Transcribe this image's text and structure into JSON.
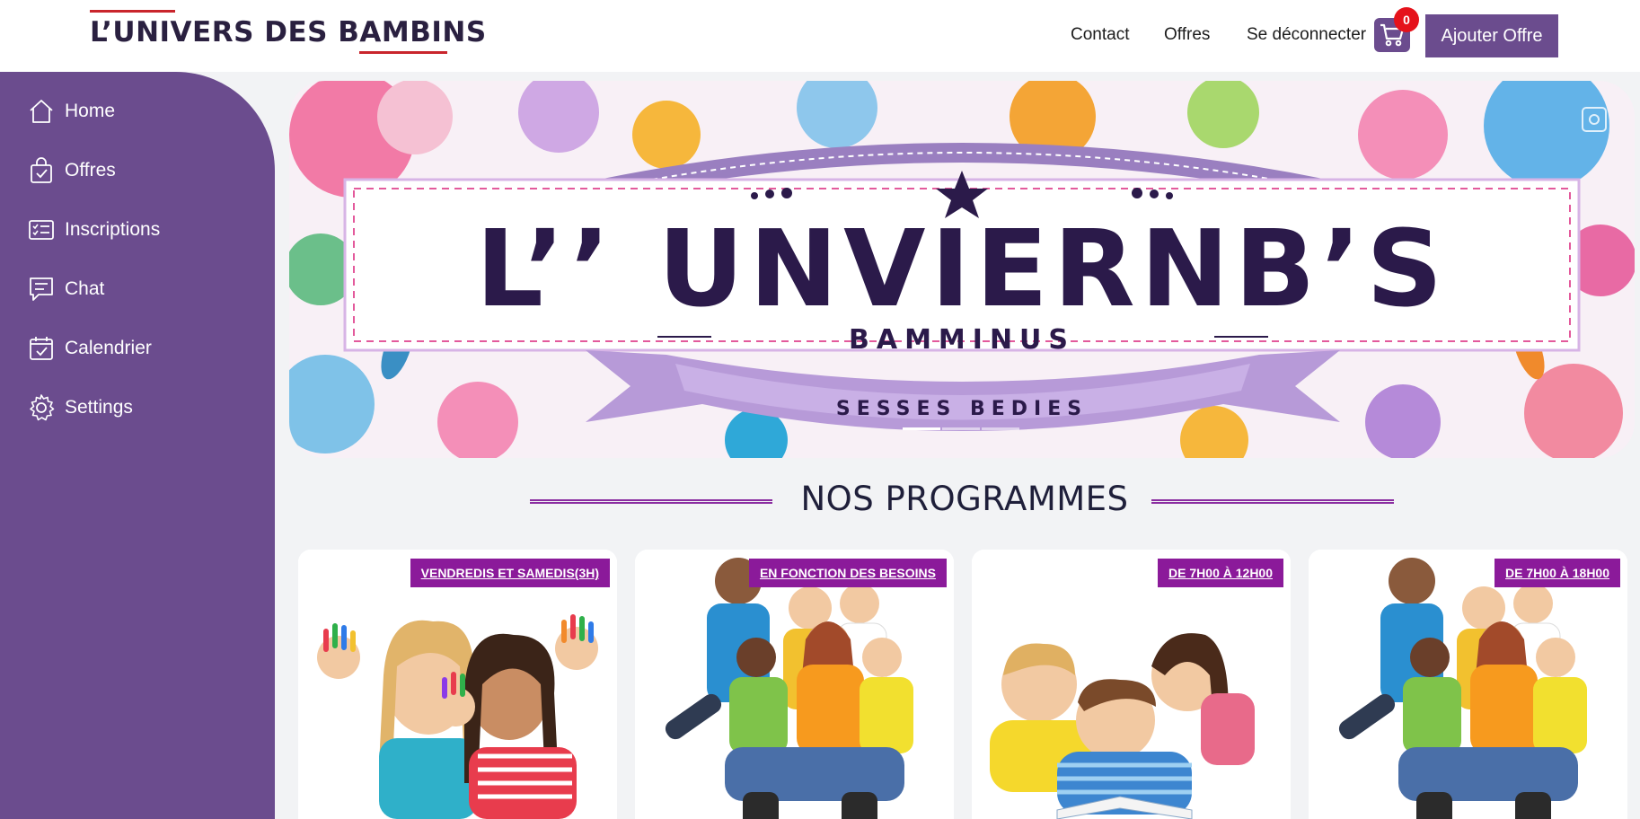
{
  "header": {
    "logo_text": "L’UNIVERS DES BAMBINS",
    "nav": [
      "Contact",
      "Offres",
      "Se déconnecter"
    ],
    "cart_count": "0",
    "add_offer_label": "Ajouter Offre"
  },
  "sidebar": {
    "items": [
      {
        "label": "Home",
        "icon": "home-icon"
      },
      {
        "label": "Offres",
        "icon": "shopping-bag-icon"
      },
      {
        "label": "Inscriptions",
        "icon": "checklist-icon"
      },
      {
        "label": "Chat",
        "icon": "chat-icon"
      },
      {
        "label": "Calendrier",
        "icon": "calendar-icon"
      },
      {
        "label": "Settings",
        "icon": "gear-icon"
      }
    ]
  },
  "hero": {
    "banner_title": "L’’ UNVIERNB’S",
    "banner_subtitle": "BAMMINUS",
    "banner_ribbon": "SESSES BEDIES",
    "slides": 3,
    "active_slide": 1
  },
  "programs": {
    "title": "NOS PROGRAMMES",
    "cards": [
      {
        "tag": "VENDREDIS ET SAMEDIS(3H)"
      },
      {
        "tag": "EN FONCTION DES BESOINS"
      },
      {
        "tag": "DE 7H00 À 12H00"
      },
      {
        "tag": "DE 7H00 À 18H00"
      }
    ]
  },
  "colors": {
    "brand_purple": "#6b4c8e",
    "tag_purple": "#8b1a9a",
    "badge_red": "#e5121b",
    "logo_red": "#c9252c"
  }
}
